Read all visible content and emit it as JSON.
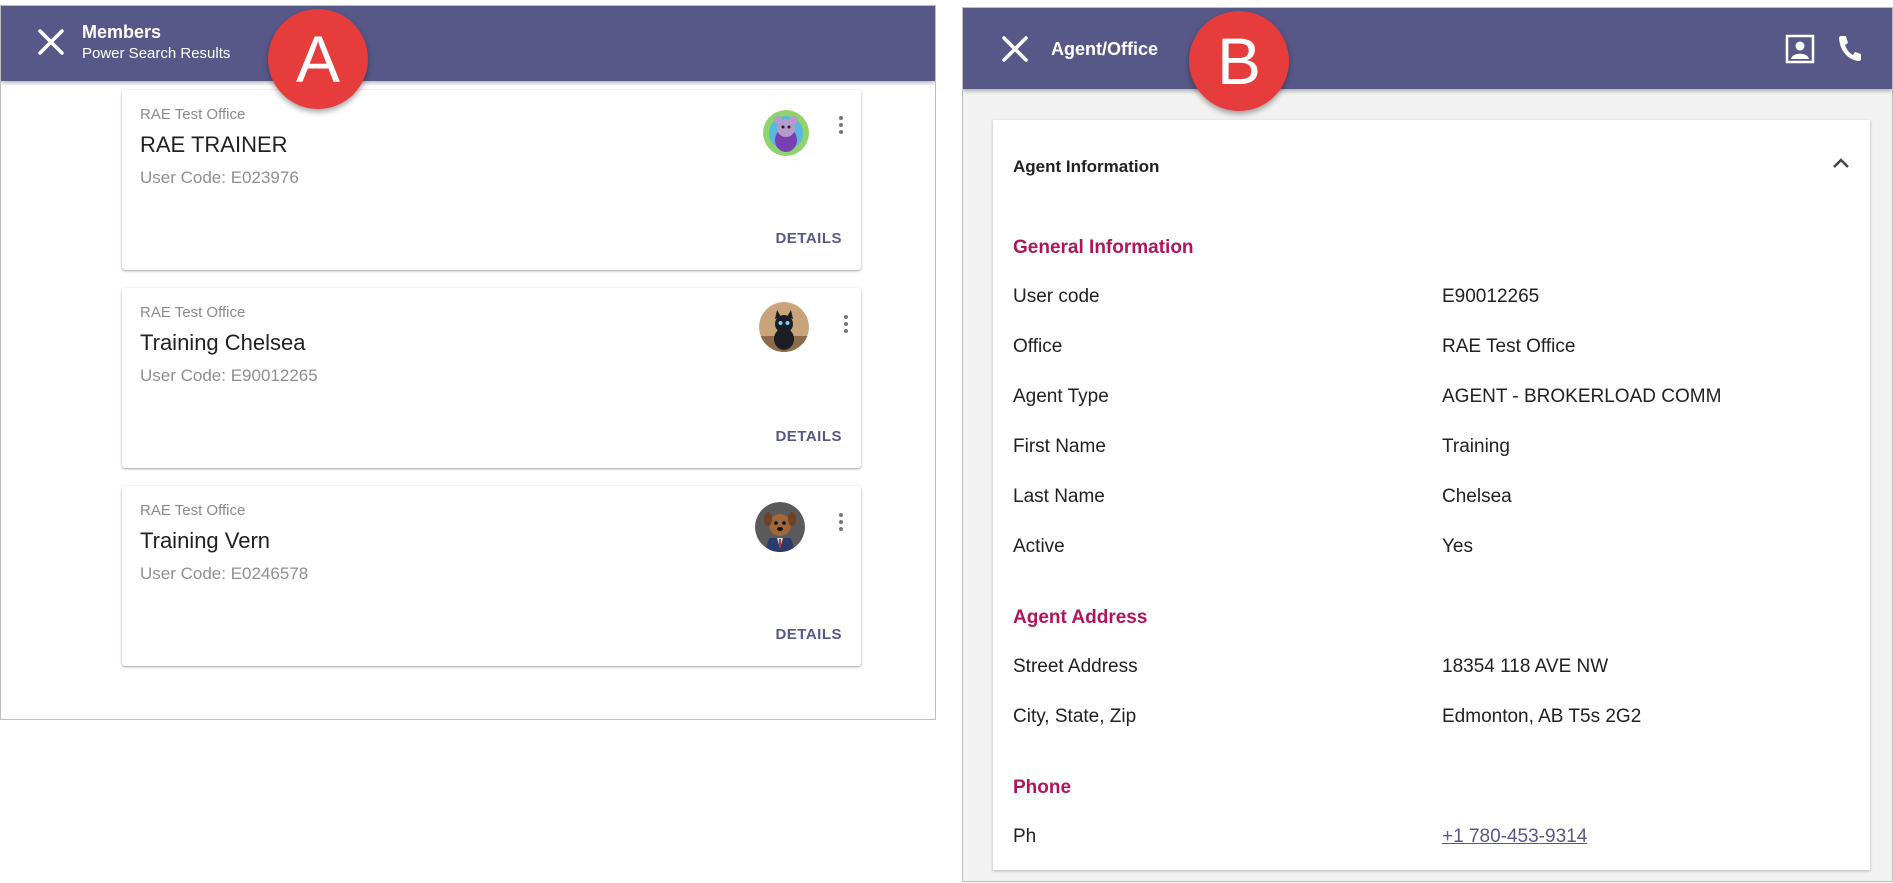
{
  "panel_a": {
    "marker": "A",
    "header": {
      "title": "Members",
      "subtitle": "Power Search Results"
    },
    "cards": [
      {
        "office": "RAE Test Office",
        "name": "RAE TRAINER",
        "user_code": "User Code: E023976",
        "details_label": "DETAILS",
        "avatar": "purple-mascot-avatar"
      },
      {
        "office": "RAE Test Office",
        "name": "Training Chelsea",
        "user_code": "User Code: E90012265",
        "details_label": "DETAILS",
        "avatar": "black-cat-avatar"
      },
      {
        "office": "RAE Test Office",
        "name": "Training Vern",
        "user_code": "User Code: E0246578",
        "details_label": "DETAILS",
        "avatar": "dog-in-suit-avatar"
      }
    ]
  },
  "panel_b": {
    "marker": "B",
    "header": {
      "title": "Agent/Office",
      "icons": [
        "contact-card-icon",
        "phone-icon"
      ]
    },
    "section_title": "Agent Information",
    "general": {
      "title": "General Information",
      "rows": [
        {
          "label": "User code",
          "value": "E90012265"
        },
        {
          "label": "Office",
          "value": "RAE Test Office"
        },
        {
          "label": "Agent Type",
          "value": "AGENT - BROKERLOAD COMM"
        },
        {
          "label": "First Name",
          "value": "Training"
        },
        {
          "label": "Last Name",
          "value": "Chelsea"
        },
        {
          "label": "Active",
          "value": "Yes"
        }
      ]
    },
    "address": {
      "title": "Agent Address",
      "rows": [
        {
          "label": "Street Address",
          "value": "18354 118 AVE NW"
        },
        {
          "label": "City, State, Zip",
          "value": "Edmonton, AB T5s 2G2"
        }
      ]
    },
    "phone": {
      "title": "Phone",
      "rows": [
        {
          "label": "Ph",
          "value": "+1 780-453-9314"
        }
      ]
    }
  },
  "colors": {
    "header": "#585888",
    "section_accent": "#b0155a",
    "marker": "#e63c3c",
    "link": "#585888"
  }
}
